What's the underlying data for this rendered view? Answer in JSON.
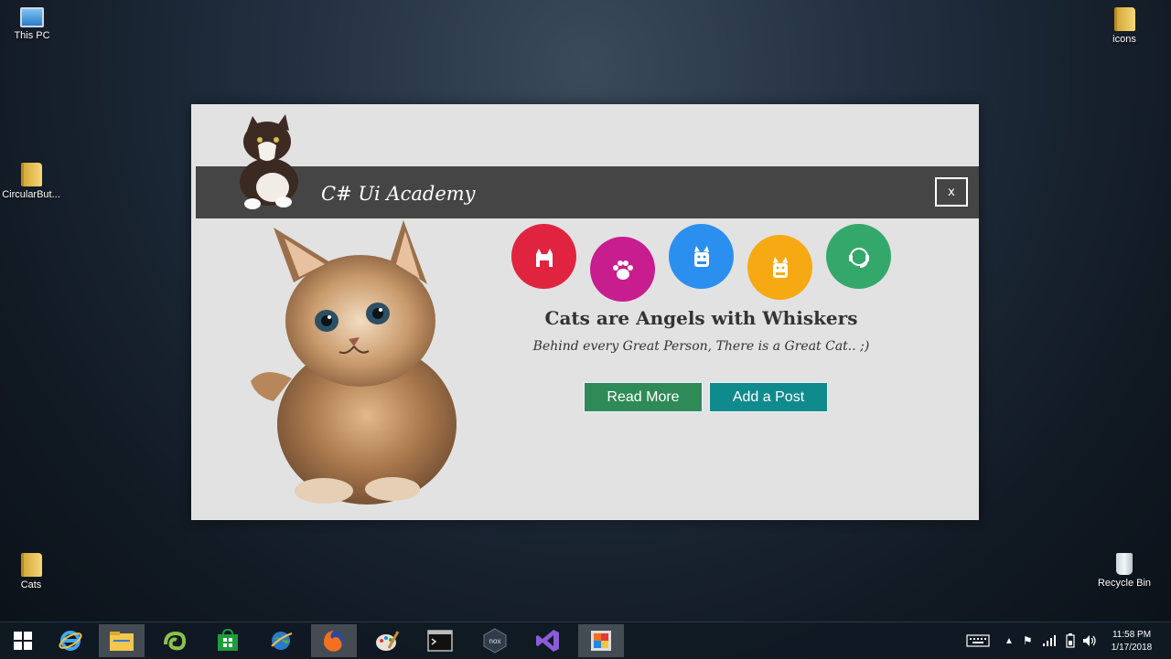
{
  "desktop": {
    "icons": [
      {
        "label": "This PC"
      },
      {
        "label": "CircularBut..."
      },
      {
        "label": "Cats"
      },
      {
        "label": "icons"
      },
      {
        "label": "Recycle Bin"
      }
    ]
  },
  "app": {
    "title": "C# Ui Academy",
    "close_label": "x",
    "headline": "Cats are Angels with Whiskers",
    "subline": "Behind every Great Person, There is a Great Cat.. ;)",
    "buttons": {
      "read_more": "Read More",
      "add_post": "Add a Post"
    },
    "circles": [
      {
        "icon": "cat-icon",
        "color": "#e0243f"
      },
      {
        "icon": "paw-icon",
        "color": "#c81d8e"
      },
      {
        "icon": "lucky-cat-icon",
        "color": "#2b8ff0"
      },
      {
        "icon": "lucky-cat-icon",
        "color": "#f6a912"
      },
      {
        "icon": "headset-icon",
        "color": "#34a86a"
      }
    ],
    "colors": {
      "read_more": "#2e8b57",
      "add_post": "#0f8b8d",
      "titlebar": "#454545"
    }
  },
  "taskbar": {
    "apps": [
      "start-icon",
      "internet-explorer-icon",
      "file-explorer-icon",
      "chameleon-icon",
      "store-icon",
      "network-globe-icon",
      "firefox-icon",
      "paint-icon",
      "command-prompt-icon",
      "nox-icon",
      "visual-studio-icon",
      "app-window-icon"
    ],
    "active_app": "file-explorer-icon",
    "clock": {
      "time": "11:58 PM",
      "date": "1/17/2018"
    }
  }
}
